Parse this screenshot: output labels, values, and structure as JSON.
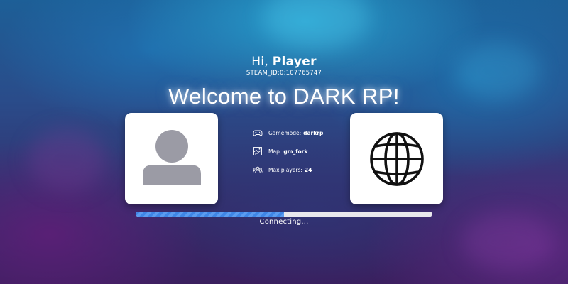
{
  "greeting": {
    "prefix": "Hi,",
    "player_name": "Player"
  },
  "steam_id": "STEAM_ID:0:107765747",
  "welcome_title": "Welcome to DARK RP!",
  "cards": {
    "left_icon": "user-avatar-icon",
    "right_icon": "globe-icon"
  },
  "server_info": [
    {
      "icon": "gamepad-icon",
      "label": "Gamemode:",
      "value": "darkrp"
    },
    {
      "icon": "map-icon",
      "label": "Map:",
      "value": "gm_fork"
    },
    {
      "icon": "players-icon",
      "label": "Max players:",
      "value": "24"
    }
  ],
  "progress": {
    "fraction": 0.5,
    "status": "Connecting..."
  },
  "colors": {
    "progress_fill": "#3f86e6",
    "progress_track": "#e8e8ec",
    "avatar_gray": "#9b9ba5",
    "card_bg": "#ffffff"
  }
}
